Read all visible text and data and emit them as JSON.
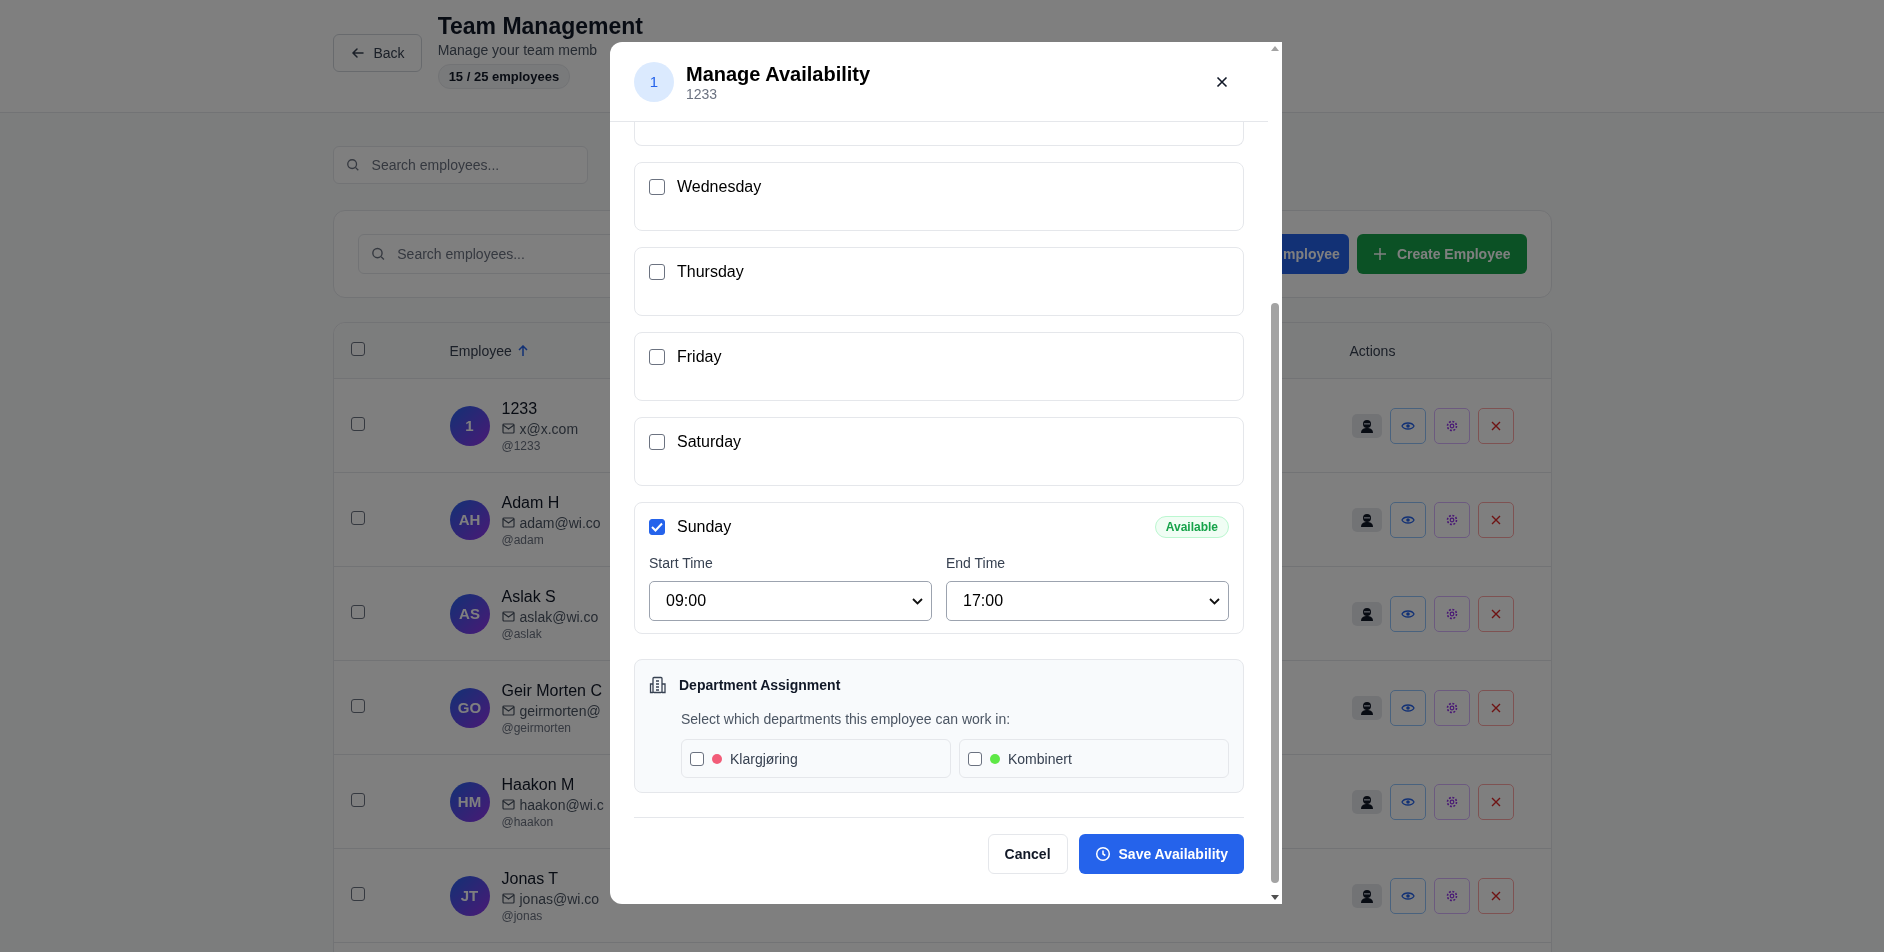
{
  "header": {
    "back": "Back",
    "title": "Team Management",
    "subtitle": "Manage your team memb",
    "count": "15 / 25 employees"
  },
  "top_search": {
    "placeholder": "Search employees..."
  },
  "filters": {
    "search": {
      "placeholder": "Search employees..."
    },
    "buttons": [
      {
        "label": "mployee",
        "kind": "primary"
      },
      {
        "label": "Create Employee",
        "kind": "create"
      }
    ]
  },
  "table": {
    "header_checked": false,
    "columns": [
      {
        "label": "Employee",
        "sorted": true
      },
      {
        "label": "Actions"
      }
    ],
    "rows": [
      {
        "initials": "1",
        "name": "1233",
        "email": "x@x.com",
        "username": "@1233",
        "checked": false
      },
      {
        "initials": "AH",
        "name": "Adam H",
        "email": "adam@wi.co",
        "username": "@adam",
        "checked": false
      },
      {
        "initials": "AS",
        "name": "Aslak S",
        "email": "aslak@wi.co",
        "username": "@aslak",
        "checked": false
      },
      {
        "initials": "GO",
        "name": "Geir Morten C",
        "email": "geirmorten@",
        "username": "@geirmorten",
        "checked": false
      },
      {
        "initials": "HM",
        "name": "Haakon M",
        "email": "haakon@wi.c",
        "username": "@haakon",
        "checked": false
      },
      {
        "initials": "JT",
        "name": "Jonas T",
        "email": "jonas@wi.co",
        "username": "@jonas",
        "checked": false
      }
    ]
  },
  "modal": {
    "avatar": "1",
    "title": "Manage Availability",
    "subtitle": "1233",
    "days": [
      {
        "name": "Wednesday",
        "checked": false
      },
      {
        "name": "Thursday",
        "checked": false
      },
      {
        "name": "Friday",
        "checked": false
      },
      {
        "name": "Saturday",
        "checked": false
      },
      {
        "name": "Sunday",
        "checked": true,
        "badge": "Available",
        "start_label": "Start Time",
        "start": "09:00",
        "end_label": "End Time",
        "end": "17:00"
      }
    ],
    "departments": {
      "title": "Department Assignment",
      "hint": "Select which departments this employee can work in:",
      "items": [
        {
          "name": "Klargjøring",
          "color": "#f25c78",
          "checked": false
        },
        {
          "name": "Kombinert",
          "color": "#5ee846",
          "checked": false
        }
      ]
    },
    "actions": {
      "cancel": "Cancel",
      "save": "Save Availability"
    }
  }
}
